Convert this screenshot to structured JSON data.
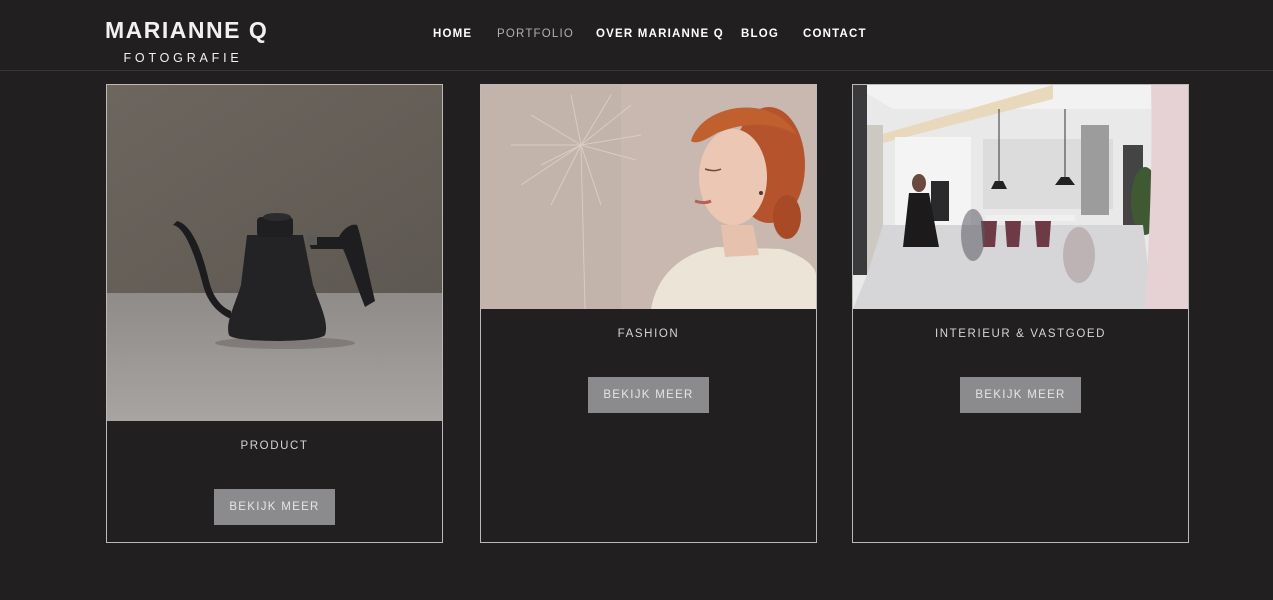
{
  "logo": {
    "name": "MARIANNE Q",
    "subtitle": "FOTOGRAFIE"
  },
  "nav": {
    "items": [
      "HOME",
      "PORTFOLIO",
      "OVER MARIANNE Q",
      "BLOG",
      "CONTACT"
    ],
    "active": "PORTFOLIO"
  },
  "cards": [
    {
      "title": "PRODUCT",
      "button": "BEKIJK MEER",
      "image": "kettle-photo"
    },
    {
      "title": "FASHION",
      "button": "BEKIJK MEER",
      "image": "portrait-photo"
    },
    {
      "title": "INTERIEUR & VASTGOED",
      "button": "BEKIJK MEER",
      "image": "interior-photo"
    }
  ],
  "colors": {
    "background": "#221f20",
    "button": "#8b8a8d",
    "border": "#bdb9b9"
  }
}
